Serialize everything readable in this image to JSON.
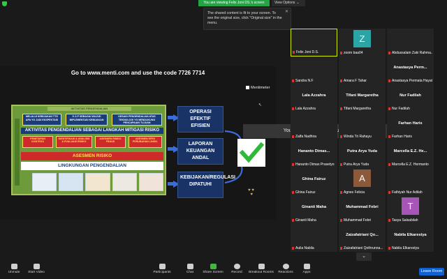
{
  "top_bar": {
    "share_banner": "You are viewing Felix Joni DS.'s screen",
    "view_options": "View Options",
    "tooltip": "The shared content is fit to your screen. To see the original size, click \"Original size\" in the menu."
  },
  "shared_screen": {
    "menti_prompt": "Go to www.menti.com and use the code 7726 7714",
    "menti_brand": "Mentimeter",
    "slide": {
      "header": "AKTIVITAS PENGENDALIAN",
      "side_label": "INFORMASI & KOMUNIKASI",
      "top_boxes": [
        "MELALUI KEBIJAKAN TTG APA YG JADI EKSPEKTASI",
        "S O P SEBAGAI WUJUD IMPLEMENTASI KEBIJAKAN",
        "DESAIN PENGENDALIAN ATAS TEKNOLOGI YG MENDUKUNG PENCAPAIAN TUJUAN"
      ],
      "band_title": "AKTIVITAS PENGENDALIAN SEBAGAI LANGKAH MITIGASI RISIKO",
      "risk_boxes": [
        "PENETAPAN KONTEKS",
        "IDENTIFIKASI & ANALISIS & EVALUASI RISIKO",
        "ASESMEN RISIKO FRAUD",
        "ASESMEN EFEK PERUBAHAN LINGK."
      ],
      "asesmen_band": "ASESMEN RISIKO",
      "lingkungan_band": "LINGKUNGAN PENGENDALIAN"
    },
    "outcomes": [
      "OPERASI EFEKTIF EFISIEN",
      "LAPORAN KEUANGAN ANDAL",
      "KEBIJAKAN/REGULASI DIPATUHI"
    ],
    "breakout_banner": "You are now in a Breakout Room"
  },
  "gallery": [
    {
      "label": "Felix Joni D.S.",
      "name": "",
      "active": true
    },
    {
      "label": "zoom baa04",
      "name": "",
      "letter": "Z",
      "color": "#2aa4a4"
    },
    {
      "label": "Abdussalam Zaki Rahma...",
      "name": ""
    },
    {
      "label": "Sandra N.F",
      "name": ""
    },
    {
      "label": "Amara F Tahar",
      "name": ""
    },
    {
      "label": "Anastasya Permata Hayati",
      "name": "Anastasya Perm..."
    },
    {
      "label": "Lala Azzahra",
      "name": "Lala Azzahra"
    },
    {
      "label": "Tifani Margaretha",
      "name": "Tifani Margaretha"
    },
    {
      "label": "Nur Fadilah",
      "name": "Nur Fadilah"
    },
    {
      "label": "Zalfa Nadhira",
      "name": ""
    },
    {
      "label": "Winda Tri Rahayu",
      "name": ""
    },
    {
      "label": "Farhan Haris",
      "name": "Farhan Haris"
    },
    {
      "label": "Hananto Dimas Prasetyo",
      "name": "Hananto Dimas..."
    },
    {
      "label": "Putra Arya Yuda",
      "name": "Putra Arya Yuda"
    },
    {
      "label": "Marcella E.Z. Hermanto",
      "name": "Marcella E.Z. He..."
    },
    {
      "label": "Ghina Fairuz",
      "name": "Ghina Fairuz"
    },
    {
      "label": "Agnes Felicia",
      "name": "",
      "letter": "A",
      "color": "#8a5a3a"
    },
    {
      "label": "Fathiyah Nur Adilah",
      "name": ""
    },
    {
      "label": "Ginanti Maha",
      "name": "Ginanti Maha"
    },
    {
      "label": "Muhammad Febri",
      "name": "Muhammad Febri"
    },
    {
      "label": "Tasya Salsabilah",
      "name": "",
      "letter": "T",
      "color": "#a855b8"
    },
    {
      "label": "Aulia Nabila",
      "name": ""
    },
    {
      "label": "Zaizafatriani Qothrunna...",
      "name": "Zaizafatriani Qo..."
    },
    {
      "label": "Nabila Elkarestya",
      "name": "Nabila Elkarestya"
    }
  ],
  "toolbar": {
    "unmute": "Unmute",
    "start_video": "Start Video",
    "participants": "Participants",
    "participants_count": "25",
    "chat": "Chat",
    "share_screen": "Share Screen",
    "record": "Record",
    "breakout_rooms": "Breakout Rooms",
    "reactions": "Reactions",
    "apps": "Apps",
    "leave": "Leave Room"
  }
}
